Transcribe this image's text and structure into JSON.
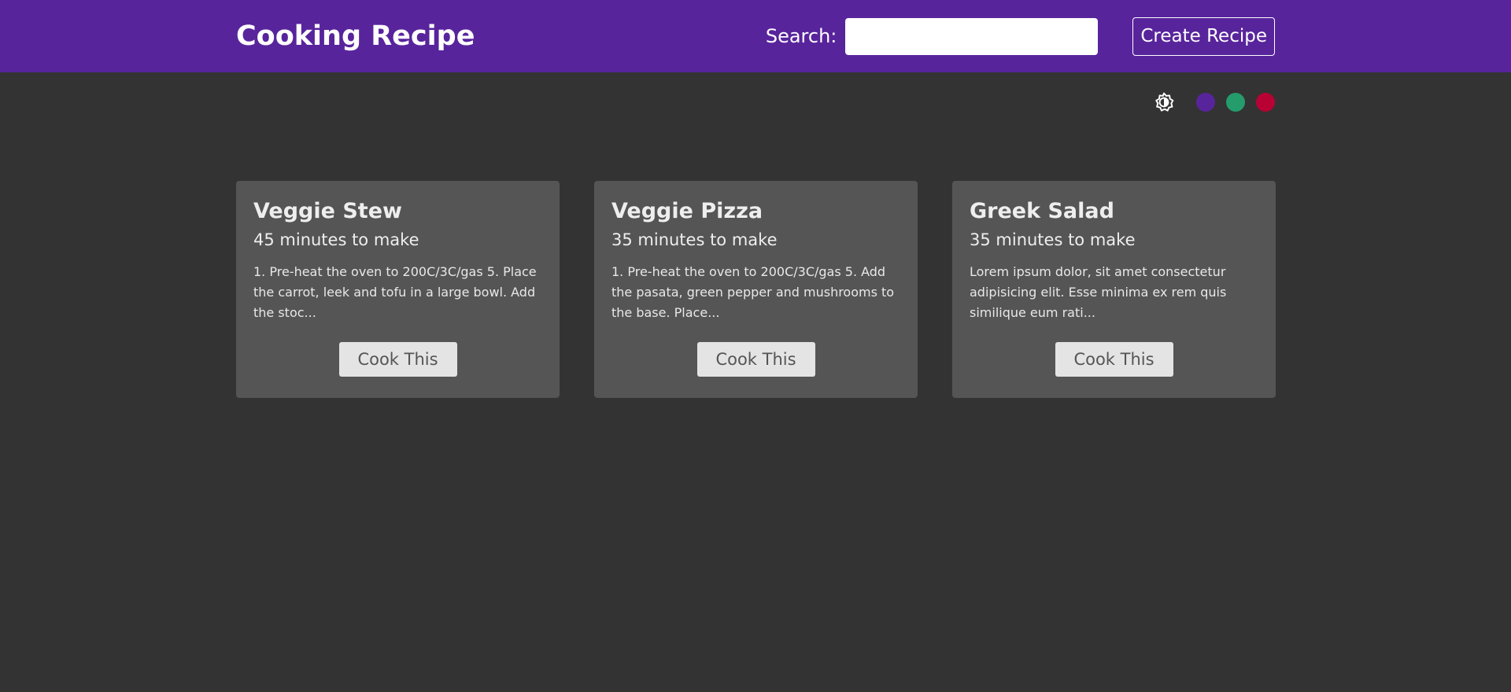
{
  "navbar": {
    "brand": "Cooking Recipe",
    "search_label": "Search:",
    "search_value": "",
    "create_label": "Create Recipe",
    "background_color": "#58249c"
  },
  "theme": {
    "mode_icon": "brightness-toggle-icon",
    "swatches": [
      {
        "name": "purple",
        "color": "#58249c"
      },
      {
        "name": "green",
        "color": "#249c6b"
      },
      {
        "name": "red",
        "color": "#b70233"
      }
    ]
  },
  "recipes": [
    {
      "title": "Veggie Stew",
      "time": "45 minutes to make",
      "excerpt": "1. Pre-heat the oven to 200C/3C/gas 5. Place the carrot, leek and tofu in a large bowl. Add the stoc...",
      "button_label": "Cook This"
    },
    {
      "title": "Veggie Pizza",
      "time": "35 minutes to make",
      "excerpt": "1. Pre-heat the oven to 200C/3C/gas 5. Add the pasata, green pepper and mushrooms to the base. Place...",
      "button_label": "Cook This"
    },
    {
      "title": "Greek Salad",
      "time": "35 minutes to make",
      "excerpt": "Lorem ipsum dolor, sit amet consectetur adipisicing elit. Esse minima ex rem quis similique eum rati...",
      "button_label": "Cook This"
    }
  ]
}
